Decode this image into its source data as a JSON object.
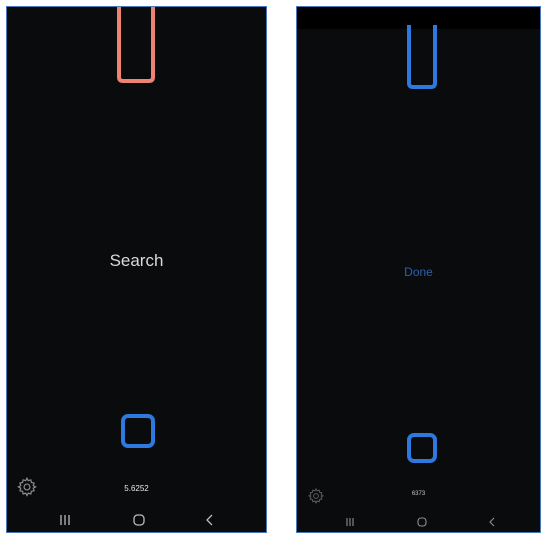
{
  "left_phone": {
    "label": "Search",
    "readout": "5.6252",
    "top_marker_color": "#ee8273",
    "bottom_marker_color": "#2d79df",
    "icons": {
      "settings": "gear-icon",
      "recents": "recent-apps-icon",
      "home": "home-icon",
      "back": "back-icon"
    }
  },
  "right_phone": {
    "label": "Done",
    "readout": "6373",
    "top_marker_color": "#2d79df",
    "bottom_marker_color": "#2d79df",
    "icons": {
      "settings": "gear-icon",
      "recents": "recent-apps-icon",
      "home": "home-icon",
      "back": "back-icon"
    }
  }
}
